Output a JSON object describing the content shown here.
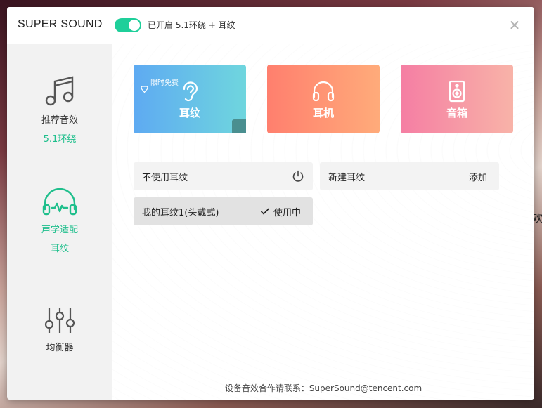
{
  "app": {
    "title": "SUPER SOUND",
    "status_text": "已开启 5.1环绕 + 耳纹",
    "toggle_on": true,
    "close_symbol": "✕"
  },
  "background": {
    "edge_text": "欢"
  },
  "sidebar": {
    "items": [
      {
        "icon": "music-note-icon",
        "label": "推荐音效",
        "sub": "5.1环绕"
      },
      {
        "icon": "headphone-wave-icon",
        "label": "声学适配",
        "sub": "耳纹"
      },
      {
        "icon": "equalizer-icon",
        "label": "均衡器",
        "sub": ""
      }
    ]
  },
  "cards": [
    {
      "icon": "ear-icon",
      "label": "耳纹",
      "badge": "限时免费",
      "selected": true
    },
    {
      "icon": "headphone-icon",
      "label": "耳机"
    },
    {
      "icon": "speaker-icon",
      "label": "音箱"
    }
  ],
  "rows": {
    "no_earprint": {
      "label": "不使用耳纹",
      "icon": "power-icon"
    },
    "new_earprint": {
      "label": "新建耳纹",
      "action": "添加"
    },
    "my_earprint": {
      "label": "我的耳纹1(头戴式)",
      "status": "使用中",
      "icon": "checkmark-icon"
    }
  },
  "footer": {
    "text": "设备音效合作请联系：SuperSound@tencent.com"
  },
  "colors": {
    "accent": "#1fcf9a",
    "accent_text": "#1fbf8c"
  }
}
